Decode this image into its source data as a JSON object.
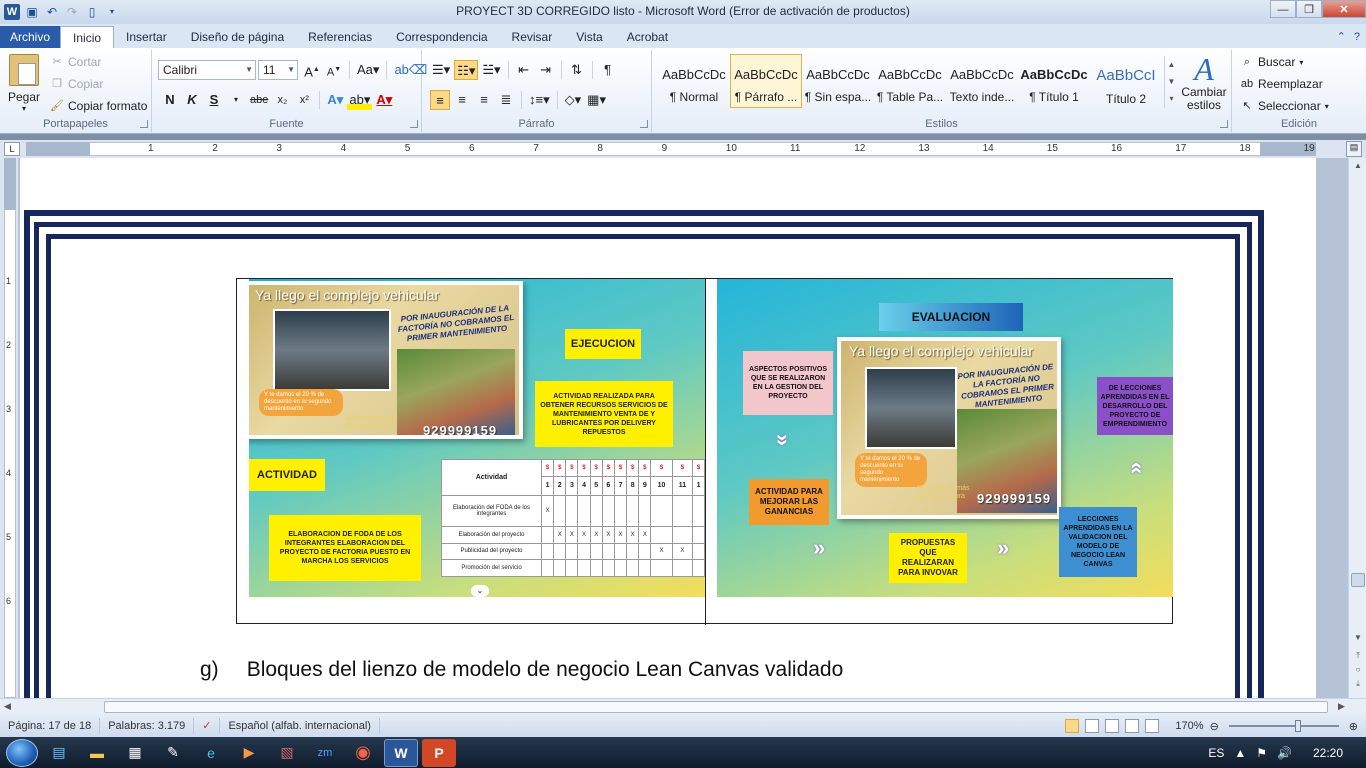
{
  "window": {
    "title": "PROYECT 3D CORREGIDO listo  -  Microsoft Word (Error de activación de productos)"
  },
  "ribbon_tabs": [
    "Archivo",
    "Inicio",
    "Insertar",
    "Diseño de página",
    "Referencias",
    "Correspondencia",
    "Revisar",
    "Vista",
    "Acrobat"
  ],
  "clipboard": {
    "paste": "Pegar",
    "cut": "Cortar",
    "copy": "Copiar",
    "format_painter": "Copiar formato",
    "group_label": "Portapapeles"
  },
  "font": {
    "name": "Calibri",
    "size": "11",
    "group_label": "Fuente"
  },
  "paragraph": {
    "group_label": "Párrafo"
  },
  "styles": {
    "items": [
      {
        "sample": "AaBbCcDc",
        "name": "¶ Normal"
      },
      {
        "sample": "AaBbCcDc",
        "name": "¶ Párrafo ..."
      },
      {
        "sample": "AaBbCcDc",
        "name": "¶ Sin espa..."
      },
      {
        "sample": "AaBbCcDc",
        "name": "¶ Table Pa..."
      },
      {
        "sample": "AaBbCcDc",
        "name": "Texto inde..."
      },
      {
        "sample": "AaBbCcDc",
        "name": "¶ Título 1"
      },
      {
        "sample": "AaBbCcI",
        "name": "Título 2"
      }
    ],
    "change_styles": "Cambiar estilos",
    "group_label": "Estilos"
  },
  "editing": {
    "find": "Buscar",
    "replace": "Reemplazar",
    "select": "Seleccionar",
    "group_label": "Edición"
  },
  "ruler": {
    "numbers": [
      "1",
      "2",
      "3",
      "4",
      "5",
      "6",
      "7",
      "8",
      "9",
      "10",
      "11",
      "12",
      "13",
      "14",
      "15",
      "16",
      "17",
      "18",
      "19"
    ],
    "vertical_numbers": [
      "1",
      "2",
      "3",
      "4",
      "5",
      "6"
    ]
  },
  "poster": {
    "title": "Ya llego el complejo vehicular",
    "promo": "POR INAUGURACIÓN DE LA FACTORÍA NO COBRAMOS EL PRIMER MANTENIMIENTO",
    "badge": "Y te damos el 20 % de descuento en tu segundo mantenimiento",
    "sub": "NO esperes más llámanos ahora",
    "phone": "929999159"
  },
  "left_panel": {
    "ejecucion": "EJECUCION",
    "ejecucion_desc": "ACTIVIDAD REALIZADA PARA OBTENER RECURSOS SERVICIOS DE MANTENIMIENTO VENTA DE Y LUBRICANTES POR DELIVERY REPUESTOS",
    "actividad": "ACTIVIDAD",
    "actividad_desc": "ELABORACION DE FODA DE LOS INTEGRANTES ELABORACION DEL PROYECTO DE FACTORIA PUESTO EN MARCHA LOS SERVICIOS",
    "schedule": {
      "header": "Actividad",
      "currency": "$",
      "columns": [
        "1",
        "2",
        "3",
        "4",
        "5",
        "6",
        "7",
        "8",
        "9",
        "10",
        "11",
        "1"
      ],
      "rows": [
        {
          "activity": "Elaboración del FODA de los integrantes",
          "marks": [
            "X",
            "",
            "",
            "",
            "",
            "",
            "",
            "",
            "",
            "",
            "",
            ""
          ]
        },
        {
          "activity": "Elaboración del proyecto",
          "marks": [
            "",
            "X",
            "X",
            "X",
            "X",
            "X",
            "X",
            "X",
            "X",
            "",
            "",
            ""
          ]
        },
        {
          "activity": "Publicidad del proyecto",
          "marks": [
            "",
            "",
            "",
            "",
            "",
            "",
            "",
            "",
            "",
            "X",
            "X",
            ""
          ]
        },
        {
          "activity": "Promoción del servicio",
          "marks": [
            "",
            "",
            "",
            "",
            "",
            "",
            "",
            "",
            "",
            "",
            "",
            ""
          ]
        }
      ]
    }
  },
  "right_panel": {
    "evaluacion": "EVALUACION",
    "aspectos": "ASPECTOS POSITIVOS QUE SE REALIZARON EN LA GESTION DEL PROYECTO",
    "lecciones_1": "DE LECCIONES APRENDIDAS EN EL DESARROLLO DEL PROYECTO DE EMPRENDIMIENTO",
    "actividad_mejorar": "ACTIVIDAD PARA MEJORAR LAS GANANCIAS",
    "propuestas": "PROPUESTAS QUE REALIZARAN PARA INVOVAR",
    "lecciones_2": "LECCIONES APRENDIDAS EN LA VALIDACION DEL MODELO DE NEGOCIO LEAN CANVAS"
  },
  "document": {
    "heading_letter": "g)",
    "heading_text": "Bloques del lienzo de modelo de negocio Lean Canvas validado"
  },
  "status": {
    "page": "Página: 17 de 18",
    "words": "Palabras: 3.179",
    "language": "Español (alfab. internacional)",
    "zoom": "170%"
  },
  "taskbar": {
    "lang": "ES",
    "time": "22:20"
  },
  "colors": {
    "frame": "#17275c",
    "file_tab": "#2a5caa",
    "accent_yellow": "#fff000"
  }
}
